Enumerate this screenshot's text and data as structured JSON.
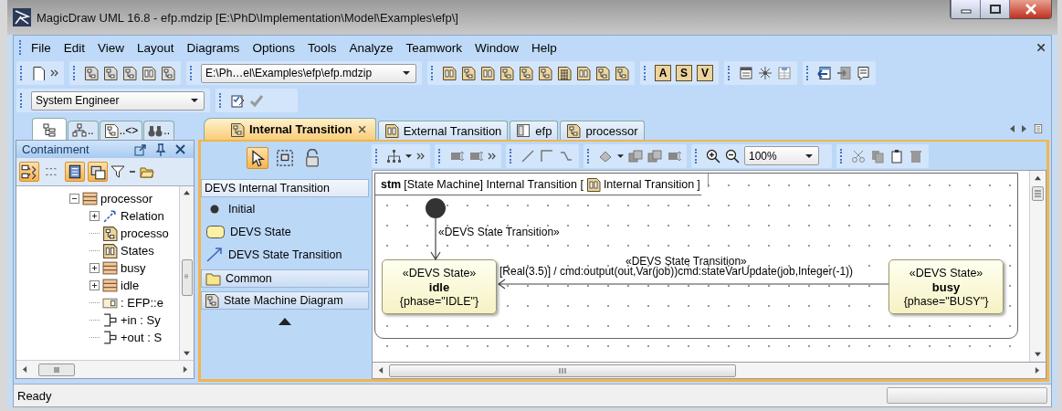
{
  "window": {
    "title": "MagicDraw UML 16.8 - efp.mdzip [E:\\PhD\\Implementation\\Model\\Examples\\efp\\]"
  },
  "menu": [
    "File",
    "Edit",
    "View",
    "Layout",
    "Diagrams",
    "Options",
    "Tools",
    "Analyze",
    "Teamwork",
    "Window",
    "Help"
  ],
  "toolbar": {
    "project_path": "E:\\Ph…el\\Examples\\efp\\efp.mdzip",
    "letter_buttons": [
      "A",
      "S",
      "V"
    ],
    "perspective": "System Engineer"
  },
  "browser": {
    "tabs": [
      {
        "selected": true
      },
      {
        "label": "..",
        "selected": false
      },
      {
        "label": "..<>",
        "selected": false
      },
      {
        "label": "..",
        "selected": false
      }
    ],
    "panel_title": "Containment",
    "toggles": [
      {
        "on": true
      },
      {
        "on": false
      },
      {
        "on": true
      },
      {
        "on": true
      }
    ],
    "tree": [
      {
        "label": "processor",
        "kind": "block",
        "expanded": true,
        "children": [
          {
            "label": "Relation",
            "kind": "relation",
            "expanded": false
          },
          {
            "label": "processo",
            "kind": "diagram"
          },
          {
            "label": "States",
            "kind": "states"
          },
          {
            "label": "busy",
            "kind": "block",
            "expanded": false
          },
          {
            "label": "idle",
            "kind": "block",
            "expanded": false
          },
          {
            "label": ": EFP::e",
            "kind": "property"
          },
          {
            "label": "+in : Sy",
            "kind": "port"
          },
          {
            "label": "+out : S",
            "kind": "port"
          }
        ]
      }
    ]
  },
  "editor": {
    "tabs": [
      {
        "label": "Internal Transition",
        "selected": true
      },
      {
        "label": "External Transition",
        "selected": false
      },
      {
        "label": "efp",
        "selected": false
      },
      {
        "label": "processor",
        "selected": false
      }
    ],
    "palette": {
      "tools": [
        {
          "selected": true
        },
        {
          "selected": false
        },
        {
          "selected": false
        }
      ],
      "groups": [
        {
          "title": "DEVS Internal Transition",
          "expanded": true,
          "items": [
            {
              "label": "Initial",
              "kind": "initial"
            },
            {
              "label": "DEVS State",
              "kind": "state"
            },
            {
              "label": "DEVS State Transition",
              "kind": "transition"
            }
          ]
        },
        {
          "title": "Common",
          "expanded": false,
          "kind": "folder"
        },
        {
          "title": "State Machine Diagram",
          "expanded": false,
          "kind": "diagram"
        }
      ]
    },
    "zoom": "100%",
    "frame": {
      "kind_label": "stm",
      "heading": "[State Machine] Internal Transition [",
      "diagram_name": "Internal Transition",
      "closing": "]"
    },
    "states": [
      {
        "stereotype": "«DEVS State»",
        "name": "idle",
        "constraint": "{phase=\"IDLE\"}"
      },
      {
        "stereotype": "«DEVS State»",
        "name": "busy",
        "constraint": "{phase=\"BUSY\"}"
      }
    ],
    "transitions": [
      {
        "stereotype": "«DEVS State Transition»"
      },
      {
        "stereotype": "«DEVS State Transition»",
        "label": "[Real(3.5)] / cmd:output(out,Var(job))cmd:stateVarUpdate(job,Integer(-1))"
      }
    ]
  },
  "status_bar": {
    "text": "Ready"
  }
}
